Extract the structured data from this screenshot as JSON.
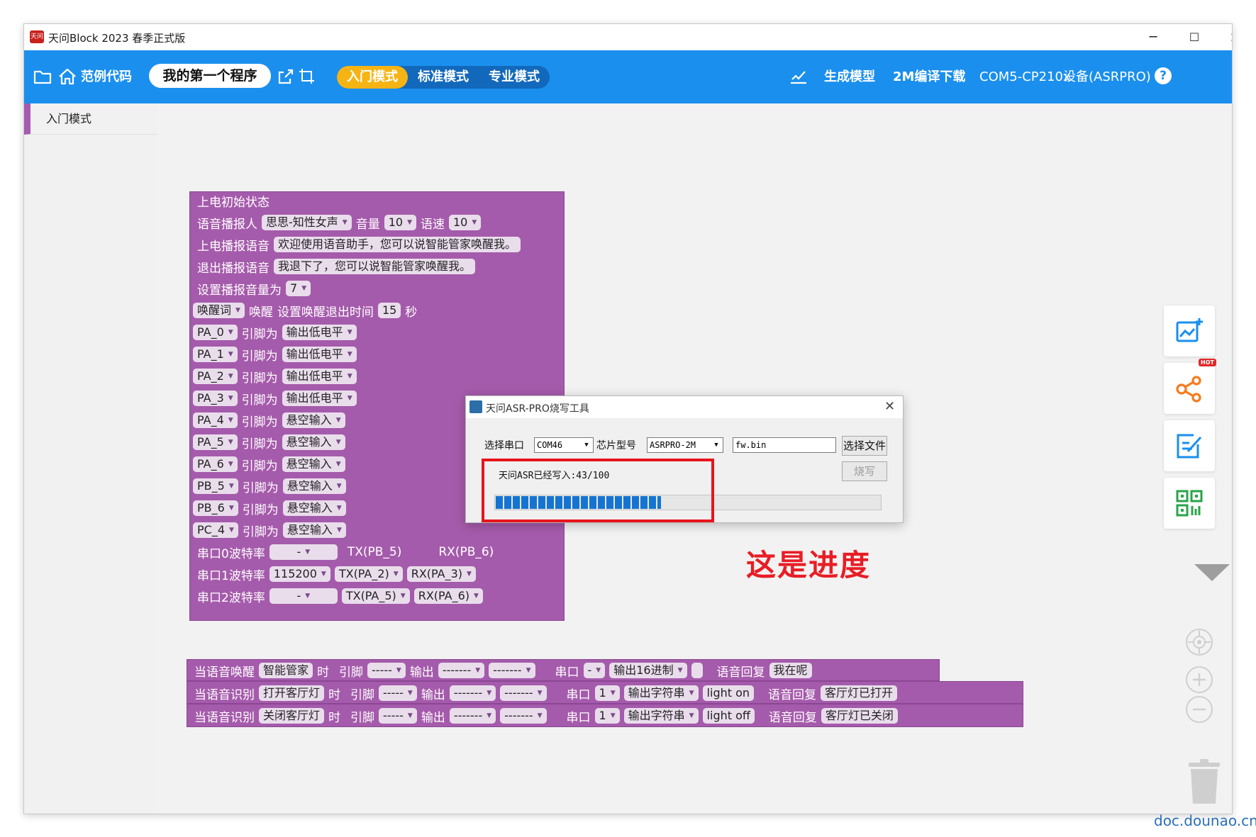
{
  "window": {
    "title": "天问Block 2023 春季正式版",
    "logo_text": "天问",
    "controls": {
      "minimize": "─",
      "maximize": "☐",
      "close": "✕"
    }
  },
  "toolbar": {
    "examples_label": "范例代码",
    "program_name": "我的第一个程序",
    "modes": [
      {
        "label": "入门模式",
        "active": true
      },
      {
        "label": "标准模式",
        "active": false
      },
      {
        "label": "专业模式",
        "active": false
      }
    ],
    "generate_model": "生成模型",
    "compile_download": "2M编译下载",
    "port": "COM5-CP210x",
    "device": "设备(ASRPRO)",
    "help": "?"
  },
  "sidebar": {
    "items": [
      {
        "label": "入门模式"
      }
    ]
  },
  "power_on_block": {
    "header": "上电初始状态",
    "voice_row": {
      "label": "语音播报人",
      "voice": "思思-知性女声",
      "volume_label": "音量",
      "volume": "10",
      "speed_label": "语速",
      "speed": "10"
    },
    "greeting_row": {
      "label": "上电播报语音",
      "text": "欢迎使用语音助手，您可以说智能管家唤醒我。"
    },
    "exit_row": {
      "label": "退出播报语音",
      "text": "我退下了，您可以说智能管家唤醒我。"
    },
    "volume_row": {
      "label": "设置播报音量为",
      "value": "7"
    },
    "wake_row": {
      "word": "唤醒词",
      "wake_label": "唤醒",
      "timeout_label": "设置唤醒退出时间",
      "timeout": "15",
      "unit": "秒"
    },
    "pins": [
      {
        "pin": "PA_0",
        "label": "引脚为",
        "mode": "输出低电平"
      },
      {
        "pin": "PA_1",
        "label": "引脚为",
        "mode": "输出低电平"
      },
      {
        "pin": "PA_2",
        "label": "引脚为",
        "mode": "输出低电平"
      },
      {
        "pin": "PA_3",
        "label": "引脚为",
        "mode": "输出低电平"
      },
      {
        "pin": "PA_4",
        "label": "引脚为",
        "mode": "悬空输入"
      },
      {
        "pin": "PA_5",
        "label": "引脚为",
        "mode": "悬空输入"
      },
      {
        "pin": "PA_6",
        "label": "引脚为",
        "mode": "悬空输入"
      },
      {
        "pin": "PB_5",
        "label": "引脚为",
        "mode": "悬空输入"
      },
      {
        "pin": "PB_6",
        "label": "引脚为",
        "mode": "悬空输入"
      },
      {
        "pin": "PC_4",
        "label": "引脚为",
        "mode": "悬空输入"
      }
    ],
    "uarts": [
      {
        "label": "串口0波特率",
        "baud": "-",
        "tx": "TX(PB_5)",
        "rx": "RX(PB_6)"
      },
      {
        "label": "串口1波特率",
        "baud": "115200",
        "tx": "TX(PA_2)",
        "rx": "RX(PA_3)"
      },
      {
        "label": "串口2波特率",
        "baud": "-",
        "tx": "TX(PA_5)",
        "rx": "RX(PA_6)"
      }
    ]
  },
  "event_blocks": [
    {
      "trigger": "当语音唤醒",
      "word": "智能管家",
      "when": "时",
      "pin_label": "引脚",
      "pin": "-----",
      "out_label": "输出",
      "out1": "-------",
      "out2": "-------",
      "uart_label": "串口",
      "uart": "-",
      "format": "输出16进制",
      "payload": "",
      "reply_label": "语音回复",
      "reply": "我在呢"
    },
    {
      "trigger": "当语音识别",
      "word": "打开客厅灯",
      "when": "时",
      "pin_label": "引脚",
      "pin": "-----",
      "out_label": "输出",
      "out1": "-------",
      "out2": "-------",
      "uart_label": "串口",
      "uart": "1",
      "format": "输出字符串",
      "payload": "light on",
      "reply_label": "语音回复",
      "reply": "客厅灯已打开"
    },
    {
      "trigger": "当语音识别",
      "word": "关闭客厅灯",
      "when": "时",
      "pin_label": "引脚",
      "pin": "-----",
      "out_label": "输出",
      "out1": "-------",
      "out2": "-------",
      "uart_label": "串口",
      "uart": "1",
      "format": "输出字符串",
      "payload": "light off",
      "reply_label": "语音回复",
      "reply": "客厅灯已关闭"
    }
  ],
  "flash_dialog": {
    "title": "天问ASR-PRO烧写工具",
    "close": "✕",
    "port_label": "选择串口",
    "port_value": "COM46",
    "chip_label": "芯片型号",
    "chip_value": "ASRPRO-2M",
    "file_value": "fw.bin",
    "choose_file": "选择文件",
    "burn": "烧写",
    "status": "天问ASR已经写入:43/100",
    "progress": 43
  },
  "annotation": "这是进度",
  "side_tools": {
    "hot_badge": "HOT"
  },
  "watermark": "doc.dounao.cn",
  "colors": {
    "toolbar": "#1a8fee",
    "active_mode": "#f6b414",
    "block": "#a55bab",
    "highlight": "#e8141b",
    "progress": "#1574d1"
  }
}
